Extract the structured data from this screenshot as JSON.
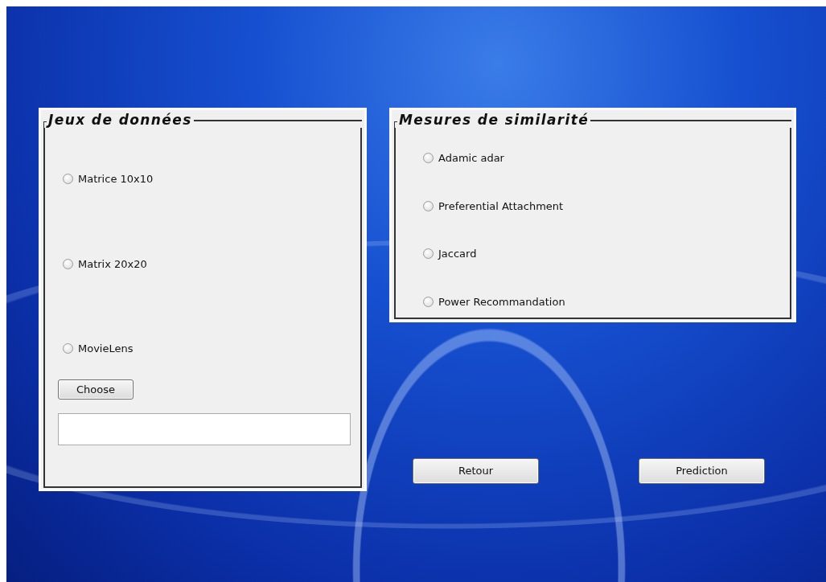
{
  "datasets": {
    "title": "Jeux de données",
    "options": [
      {
        "label": "Matrice 10x10",
        "selected": false
      },
      {
        "label": "Matrix 20x20",
        "selected": false
      },
      {
        "label": "MovieLens",
        "selected": false
      }
    ],
    "choose_button": "Choose"
  },
  "similarity": {
    "title": "Mesures de similarité",
    "options": [
      {
        "label": "Adamic adar",
        "selected": false
      },
      {
        "label": "Preferential Attachment",
        "selected": false
      },
      {
        "label": "Jaccard",
        "selected": false
      },
      {
        "label": "Power Recommandation",
        "selected": false
      }
    ]
  },
  "buttons": [
    "Retour",
    "Prediction"
  ]
}
